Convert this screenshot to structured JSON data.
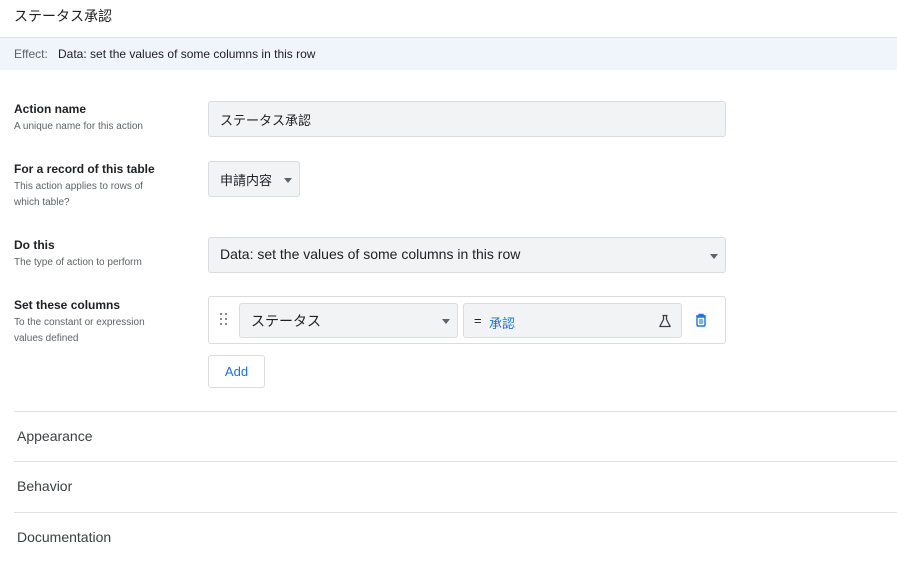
{
  "header": {
    "title": "ステータス承認"
  },
  "effect": {
    "label": "Effect:",
    "value": "Data: set the values of some columns in this row"
  },
  "form": {
    "action_name": {
      "heading": "Action name",
      "description": "A unique name for this action",
      "value": "ステータス承認"
    },
    "table": {
      "heading": "For a record of this table",
      "description_line1": "This action applies to rows of",
      "description_line2": "which table?",
      "value": "申請内容"
    },
    "do_this": {
      "heading": "Do this",
      "description": "The type of action to perform",
      "value": "Data: set the values of some columns in this row"
    },
    "set_columns": {
      "heading": "Set these columns",
      "description_line1": "To the constant or expression",
      "description_line2": "values defined",
      "rows": [
        {
          "column": "ステータス",
          "operator": "=",
          "expression": "承認"
        }
      ],
      "add_label": "Add"
    }
  },
  "sections": [
    {
      "label": "Appearance"
    },
    {
      "label": "Behavior"
    },
    {
      "label": "Documentation"
    }
  ],
  "colors": {
    "accent": "#1a73e8",
    "effect_bg": "#f0f4fb",
    "field_bg": "#f1f3f4"
  },
  "icons": [
    "drag-handle-icon",
    "dropdown-caret-icon",
    "flask-icon",
    "trash-icon"
  ]
}
